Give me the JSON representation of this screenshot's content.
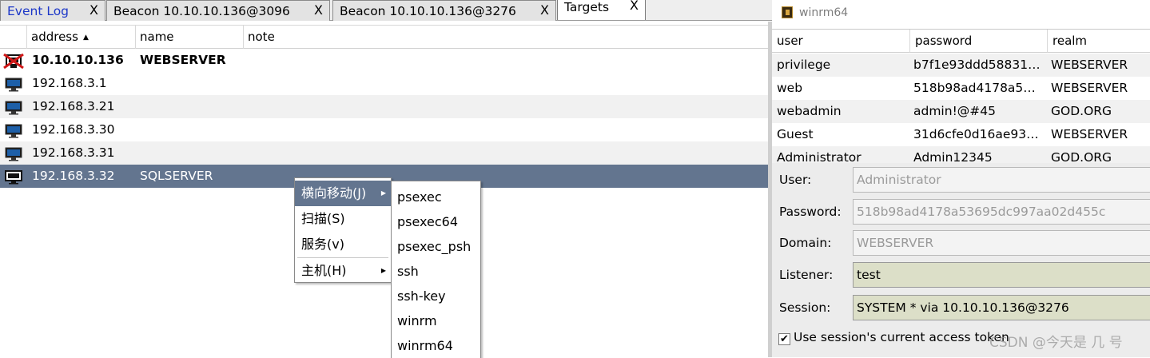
{
  "tabs": [
    {
      "label": "Event Log",
      "close": "X"
    },
    {
      "label": "Beacon 10.10.10.136@3096",
      "close": "X"
    },
    {
      "label": "Beacon 10.10.10.136@3276",
      "close": "X"
    },
    {
      "label": "Targets",
      "close": "X"
    }
  ],
  "targets": {
    "columns": {
      "address": "address",
      "name": "name",
      "note": "note"
    },
    "rows": [
      {
        "address": "10.10.10.136",
        "name": "WEBSERVER",
        "icon": "compromised-host-icon"
      },
      {
        "address": "192.168.3.1",
        "name": "",
        "icon": "windows-host-icon"
      },
      {
        "address": "192.168.3.21",
        "name": "",
        "icon": "windows-host-icon"
      },
      {
        "address": "192.168.3.30",
        "name": "",
        "icon": "windows-host-icon"
      },
      {
        "address": "192.168.3.31",
        "name": "",
        "icon": "windows-host-icon"
      },
      {
        "address": "192.168.3.32",
        "name": "SQLSERVER",
        "icon": "server-host-icon"
      }
    ]
  },
  "context_menu": {
    "items": [
      "横向移动(J)",
      "扫描(S)",
      "服务(v)",
      "主机(H)"
    ],
    "submenu": [
      "psexec",
      "psexec64",
      "psexec_psh",
      "ssh",
      "ssh-key",
      "winrm",
      "winrm64"
    ]
  },
  "dialog": {
    "title": "winrm64",
    "columns": {
      "user": "user",
      "password": "password",
      "realm": "realm"
    },
    "creds": [
      {
        "user": "privilege",
        "password": "b7f1e93ddd58831…",
        "realm": "WEBSERVER"
      },
      {
        "user": "web",
        "password": "518b98ad4178a5…",
        "realm": "WEBSERVER"
      },
      {
        "user": "webadmin",
        "password": "admin!@#45",
        "realm": "GOD.ORG"
      },
      {
        "user": "Guest",
        "password": "31d6cfe0d16ae93…",
        "realm": "WEBSERVER"
      },
      {
        "user": "Administrator",
        "password": "Admin12345",
        "realm": "GOD.ORG"
      }
    ],
    "fields": {
      "user_label": "User:",
      "user": "Administrator",
      "password_label": "Password:",
      "password": "518b98ad4178a53695dc997aa02d455c",
      "domain_label": "Domain:",
      "domain": "WEBSERVER",
      "listener_label": "Listener:",
      "listener": "test",
      "session_label": "Session:",
      "session": "SYSTEM * via  10.10.10.136@3276"
    },
    "checkbox_label": "Use session's current access token",
    "checkbox_mark": "✔"
  },
  "watermark": "CSDN @今天是 几 号"
}
